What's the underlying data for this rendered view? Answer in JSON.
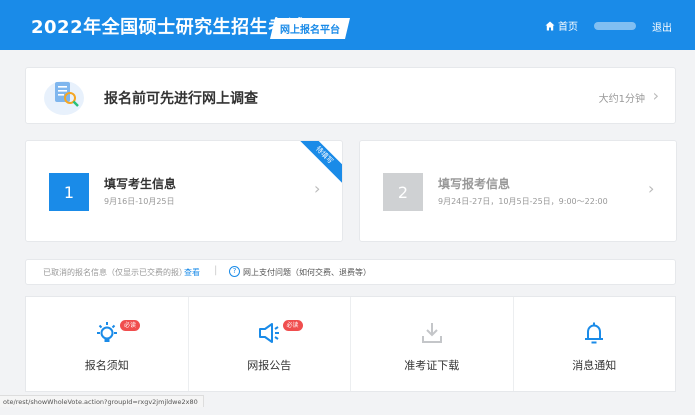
{
  "header": {
    "title": "2022年全国硕士研究生招生考试",
    "platform": "网上报名平台",
    "home": "首页",
    "logout": "退出"
  },
  "survey": {
    "title": "报名前可先进行网上调查",
    "time": "大约1分钟"
  },
  "steps": [
    {
      "number": "1",
      "title": "填写考生信息",
      "date": "9月16日-10月25日",
      "ribbon": "待填写"
    },
    {
      "number": "2",
      "title": "填写报考信息",
      "date": "9月24日-27日，10月5日-25日，9:00～22:00"
    }
  ],
  "info_bar": {
    "left": "已取消的报名信息（仅显示已交费的报）",
    "link": "查看",
    "separator": "|",
    "right": "网上支付问题（如何交费、退费等）"
  },
  "menu": [
    {
      "label": "报名须知",
      "icon": "lightbulb-icon",
      "badge": "必读"
    },
    {
      "label": "网报公告",
      "icon": "megaphone-icon",
      "badge": "必读"
    },
    {
      "label": "准考证下载",
      "icon": "download-icon"
    },
    {
      "label": "消息通知",
      "icon": "bell-icon"
    }
  ],
  "status_url": "ote/rest/showWholeVote.action?groupId=rxgv2jmjldwe2x80",
  "colors": {
    "primary": "#1a8be8",
    "badge": "#f04e4e",
    "disabled": "#cfd1d3"
  }
}
